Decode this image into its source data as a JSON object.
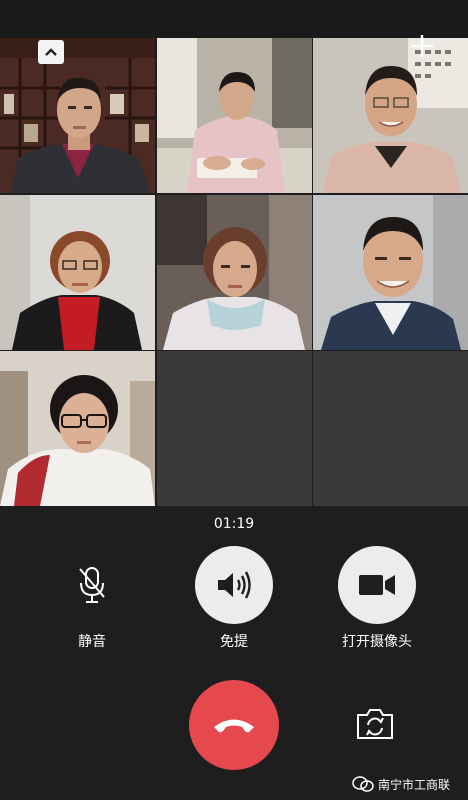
{
  "call": {
    "timer": "01:19",
    "controls": {
      "mute_label": "静音",
      "speaker_label": "免提",
      "camera_label": "打开摄像头"
    }
  },
  "participants": [
    {
      "icon": "participant-video-1"
    },
    {
      "icon": "participant-video-2"
    },
    {
      "icon": "participant-video-3"
    },
    {
      "icon": "participant-video-4"
    },
    {
      "icon": "participant-video-5"
    },
    {
      "icon": "participant-video-6"
    },
    {
      "icon": "participant-video-7"
    }
  ],
  "watermark": {
    "text": "南宁市工商联"
  },
  "colors": {
    "background": "#1e1e1e",
    "empty_tile": "#3a3a3c",
    "hangup": "#e5484d",
    "control_circle": "#ececec"
  }
}
